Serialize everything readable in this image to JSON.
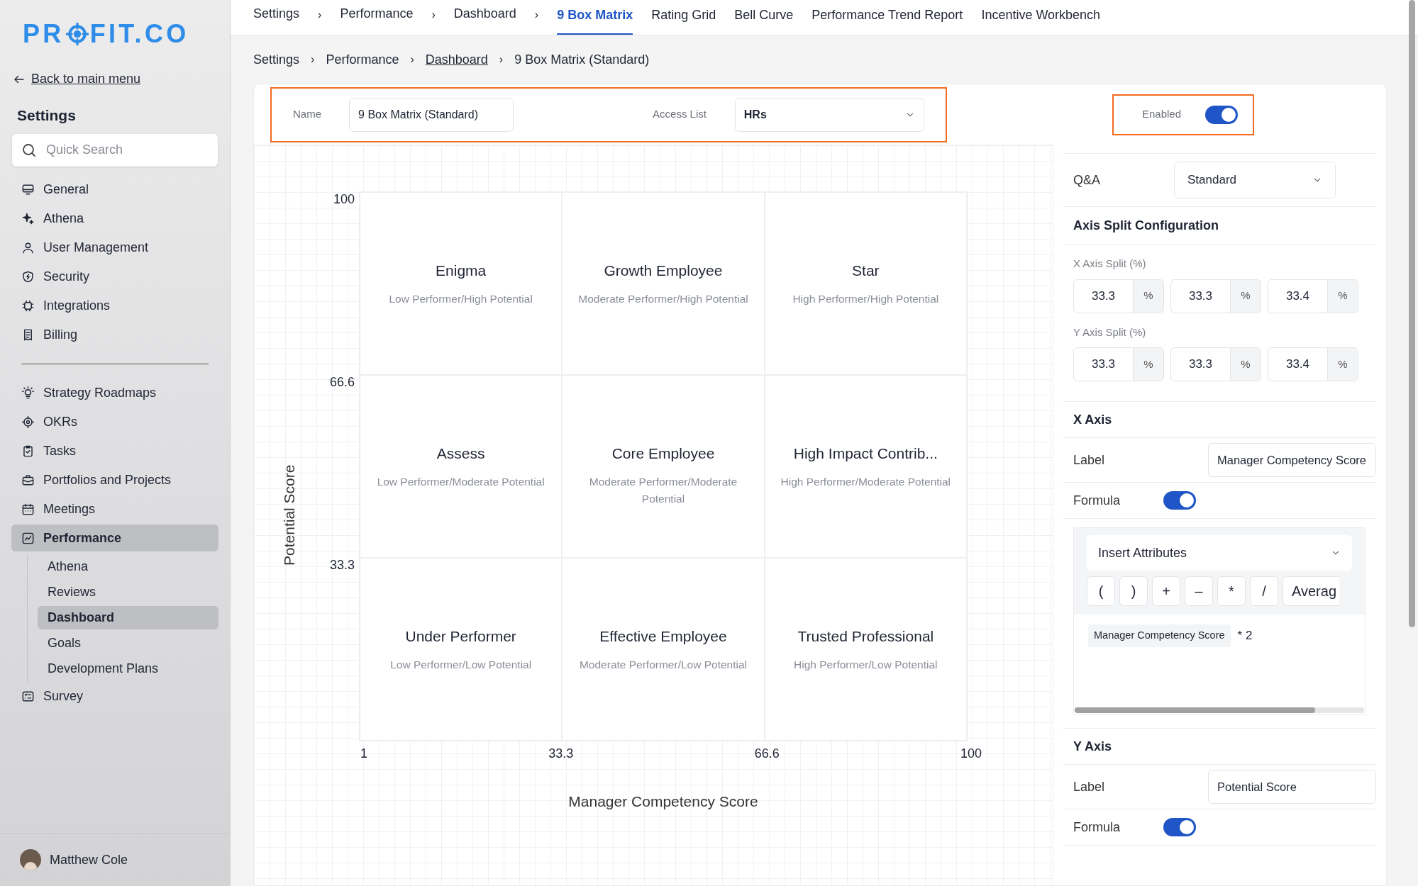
{
  "logo": {
    "text_start": "PR",
    "text_end": "FIT.CO"
  },
  "back_link": "Back to main menu",
  "sidebar": {
    "title": "Settings",
    "search": {
      "placeholder": "Quick Search"
    },
    "groups": [
      [
        {
          "label": "General",
          "selected": false
        },
        {
          "label": "Athena",
          "selected": false
        },
        {
          "label": "User Management",
          "selected": false
        },
        {
          "label": "Security",
          "selected": false
        },
        {
          "label": "Integrations",
          "selected": false
        },
        {
          "label": "Billing",
          "selected": false
        }
      ],
      [
        {
          "label": "Strategy Roadmaps",
          "selected": false
        },
        {
          "label": "OKRs",
          "selected": false
        },
        {
          "label": "Tasks",
          "selected": false
        },
        {
          "label": "Portfolios and Projects",
          "selected": false
        },
        {
          "label": "Meetings",
          "selected": false
        },
        {
          "label": "Performance",
          "selected": true,
          "children": [
            {
              "label": "Athena",
              "selected": false
            },
            {
              "label": "Reviews",
              "selected": false
            },
            {
              "label": "Dashboard",
              "selected": true
            },
            {
              "label": "Goals",
              "selected": false
            },
            {
              "label": "Development Plans",
              "selected": false
            }
          ]
        },
        {
          "label": "Survey",
          "selected": false
        }
      ]
    ]
  },
  "user": {
    "name": "Matthew Cole"
  },
  "top_breadcrumb": [
    {
      "label": "Settings",
      "separator": "›"
    },
    {
      "label": "Performance",
      "separator": "›"
    },
    {
      "label": "Dashboard",
      "separator": "›"
    }
  ],
  "tabs": [
    {
      "label": "9 Box Matrix",
      "selected": true
    },
    {
      "label": "Rating Grid",
      "selected": false
    },
    {
      "label": "Bell Curve",
      "selected": false
    },
    {
      "label": "Performance Trend Report",
      "selected": false
    },
    {
      "label": "Incentive Workbench",
      "selected": false
    }
  ],
  "breadcrumb": [
    {
      "label": "Settings",
      "link": false,
      "separator": "›"
    },
    {
      "label": "Performance",
      "link": false,
      "separator": "›"
    },
    {
      "label": "Dashboard",
      "link": true,
      "separator": "›"
    },
    {
      "label": "9 Box Matrix (Standard)",
      "link": false
    }
  ],
  "form": {
    "name": {
      "label": "Name",
      "value": "9 Box Matrix (Standard)"
    },
    "access_list": {
      "label": "Access List",
      "value": "HRs"
    },
    "enabled": {
      "label": "Enabled",
      "on": true
    }
  },
  "matrix": {
    "y_label": "Potential Score",
    "x_label": "Manager Competency Score",
    "y_ticks": [
      "100",
      "66.6",
      "33.3"
    ],
    "x_ticks": [
      "1",
      "33.3",
      "66.6",
      "100"
    ],
    "cells": [
      {
        "title": "Enigma",
        "subtitle": "Low Performer/High Potential"
      },
      {
        "title": "Growth Employee",
        "subtitle": "Moderate Performer/High Potential"
      },
      {
        "title": "Star",
        "subtitle": "High Performer/High Potential"
      },
      {
        "title": "Assess",
        "subtitle": "Low Performer/Moderate Potential"
      },
      {
        "title": "Core Employee",
        "subtitle": "Moderate Performer/Moderate Potential"
      },
      {
        "title": "High Impact Contrib...",
        "subtitle": "High Performer/Moderate Potential"
      },
      {
        "title": "Under Performer",
        "subtitle": "Low Performer/Low Potential"
      },
      {
        "title": "Effective Employee",
        "subtitle": "Moderate Performer/Low Potential"
      },
      {
        "title": "Trusted Professional",
        "subtitle": "High Performer/Low Potential"
      }
    ]
  },
  "settings_panel": {
    "qa": {
      "label": "Q&A",
      "value": "Standard"
    },
    "axis_split": {
      "title": "Axis Split Configuration",
      "x": {
        "label": "X Axis Split (%)",
        "fields": [
          {
            "value": "33.3",
            "unit": "%"
          },
          {
            "value": "33.3",
            "unit": "%"
          },
          {
            "value": "33.4",
            "unit": "%"
          }
        ]
      },
      "y": {
        "label": "Y Axis Split (%)",
        "fields": [
          {
            "value": "33.3",
            "unit": "%"
          },
          {
            "value": "33.3",
            "unit": "%"
          },
          {
            "value": "33.4",
            "unit": "%"
          }
        ]
      }
    },
    "x_axis": {
      "title": "X Axis",
      "label_field": {
        "label": "Label",
        "value": "Manager Competency Score"
      },
      "formula": {
        "label": "Formula",
        "on": true
      },
      "editor": {
        "insert": "Insert Attributes",
        "operators": [
          "(",
          ")",
          "+",
          "–",
          "*",
          "/",
          "Averag"
        ],
        "tokens": [
          {
            "kind": "chip",
            "text": "Manager Competency Score"
          },
          {
            "kind": "text",
            "text": "* 2"
          }
        ]
      }
    },
    "y_axis": {
      "title": "Y Axis",
      "label_field": {
        "label": "Label",
        "value": "Potential Score"
      },
      "formula": {
        "label": "Formula",
        "on": true
      }
    }
  }
}
